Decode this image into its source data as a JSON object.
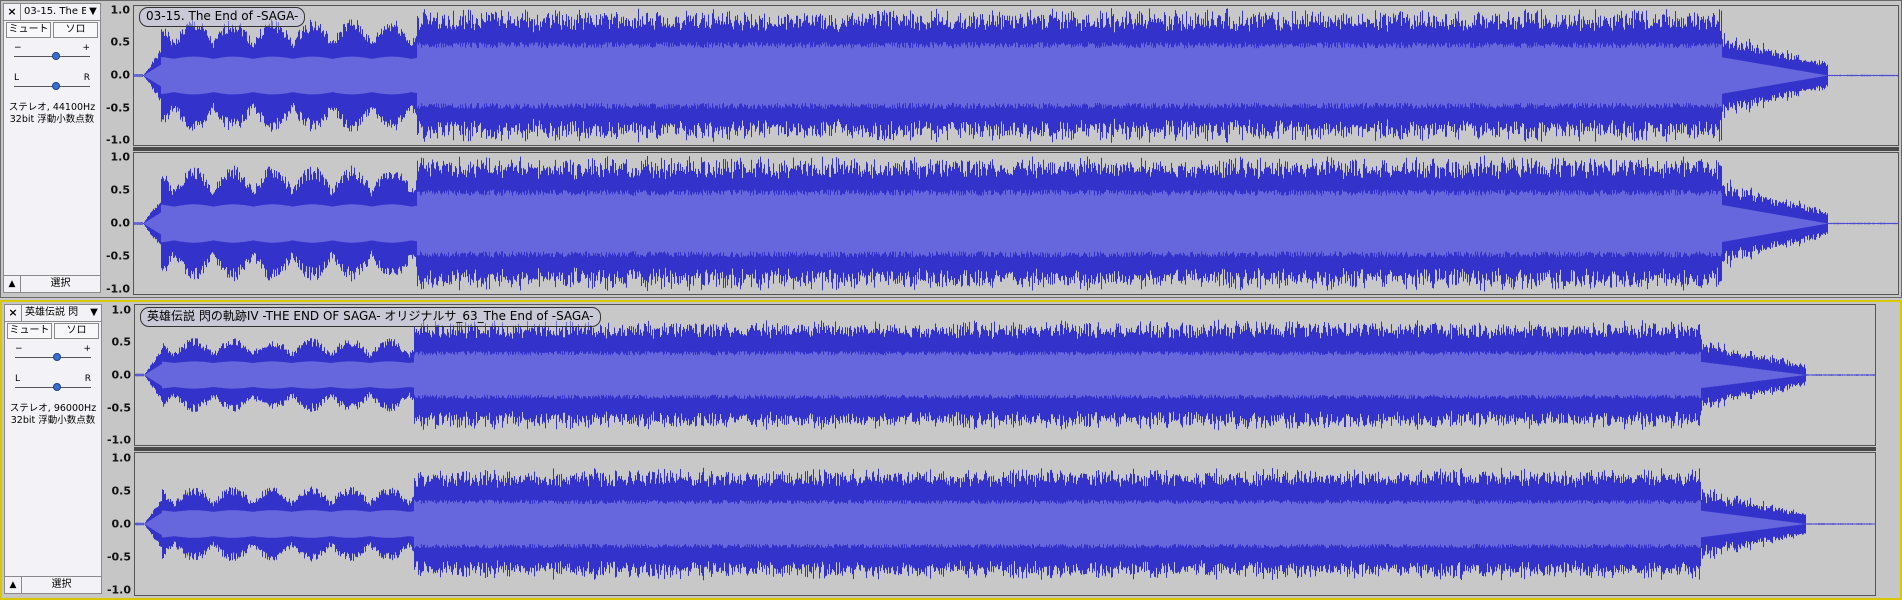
{
  "colors": {
    "wave_dark": "#3333cc",
    "wave_light": "#6666dd",
    "background": "#c8c8c8",
    "selected_border": "#d8c800"
  },
  "tracks": [
    {
      "name": "03-15. The E",
      "close_glyph": "×",
      "dropdown_glyph": "▼",
      "mute": "ミュート",
      "solo": "ソロ",
      "gain": {
        "minus": "−",
        "plus": "+"
      },
      "pan": {
        "left": "L",
        "right": "R"
      },
      "info_line1": "ステレオ, 44100Hz",
      "info_line2": "32bit 浮動小数点数",
      "collapse_glyph": "▲",
      "select": "選択",
      "clip_label": "03-15. The End of -SAGA-",
      "scale": [
        "1.0",
        "0.5",
        "0.0",
        "-0.5",
        "-1.0"
      ],
      "envelope": {
        "intro_end": 0.16,
        "dense_start": 0.16,
        "dense_end": 0.9,
        "fade_end": 0.96,
        "peaks_dense": 1.0,
        "peaks_intro": 0.85,
        "rms_dense": 0.45,
        "rms_intro": 0.28
      }
    },
    {
      "name": "英雄伝説 閃",
      "close_glyph": "×",
      "dropdown_glyph": "▼",
      "mute": "ミュート",
      "solo": "ソロ",
      "gain": {
        "minus": "−",
        "plus": "+"
      },
      "pan": {
        "left": "L",
        "right": "R"
      },
      "info_line1": "ステレオ, 96000Hz",
      "info_line2": "32bit 浮動小数点数",
      "collapse_glyph": "▲",
      "select": "選択",
      "clip_label": "英雄伝説 閃の軌跡IV -THE END OF SAGA- オリジナルサ_63_The End of -SAGA-",
      "scale": [
        "1.0",
        "0.5",
        "0.0",
        "-0.5",
        "-1.0"
      ],
      "envelope": {
        "intro_end": 0.16,
        "dense_start": 0.16,
        "dense_end": 0.9,
        "fade_end": 0.96,
        "peaks_dense": 0.82,
        "peaks_intro": 0.55,
        "rms_dense": 0.32,
        "rms_intro": 0.2
      }
    }
  ]
}
